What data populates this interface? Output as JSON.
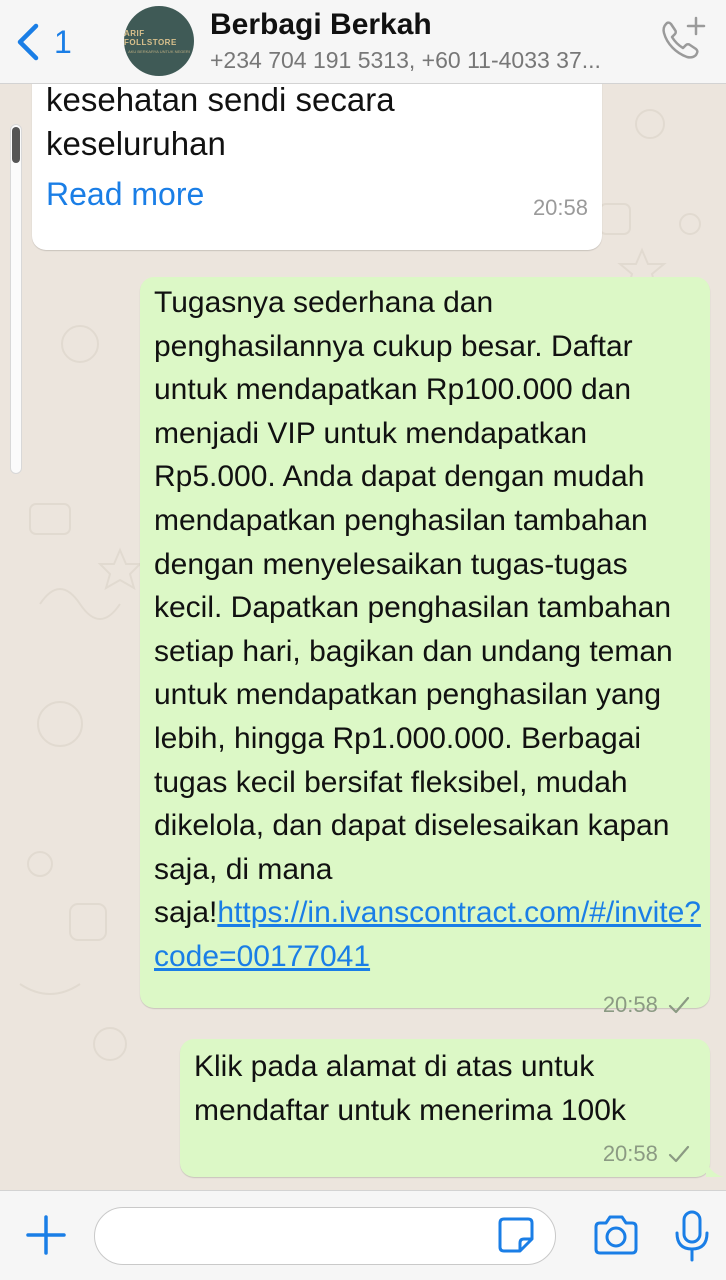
{
  "header": {
    "back_count": "1",
    "avatar_logo_text": "ARIF FOLLSTORE",
    "avatar_logo_sub": "AKU BERKARYA UNTUK NEGERI",
    "title": "Berbagi Berkah",
    "subtitle": "+234 704 191 5313, +60 11-4033 37..."
  },
  "messages": [
    {
      "direction": "incoming",
      "text_lines": [
        "kesehatan sendi secara",
        "keseluruhan"
      ],
      "read_more": "Read more",
      "time": "20:58"
    },
    {
      "direction": "outgoing",
      "text": "Tugasnya sederhana dan penghasilannya cukup besar. Daftar untuk mendapatkan Rp100.000 dan menjadi VIP untuk mendapatkan Rp5.000. Anda dapat dengan mudah mendapatkan penghasilan tambahan dengan menyelesaikan tugas-tugas kecil. Dapatkan penghasilan tambahan setiap hari, bagikan dan undang teman untuk mendapatkan penghasilan yang lebih, hingga Rp1.000.000. Berbagai tugas kecil bersifat fleksibel, mudah dikelola, dan dapat diselesaikan kapan saja, di mana saja!",
      "link": "https://in.ivanscontract.com/#/invite?code=00177041",
      "time": "20:58"
    },
    {
      "direction": "outgoing",
      "text": "Klik pada alamat di atas untuk mendaftar untuk menerima 100k",
      "time": "20:58"
    }
  ],
  "footer": {
    "input_value": "",
    "input_placeholder": ""
  },
  "icons": [
    "back-chevron-icon",
    "call-add-icon",
    "plus-icon",
    "sticker-icon",
    "camera-icon",
    "microphone-icon",
    "read-check-icon"
  ],
  "colors": {
    "accent": "#1a7ee6",
    "outgoing_bubble": "#dcf8c6",
    "incoming_bubble": "#ffffff",
    "chat_background": "#ece5dd",
    "bar_background": "#f6f6f6"
  }
}
